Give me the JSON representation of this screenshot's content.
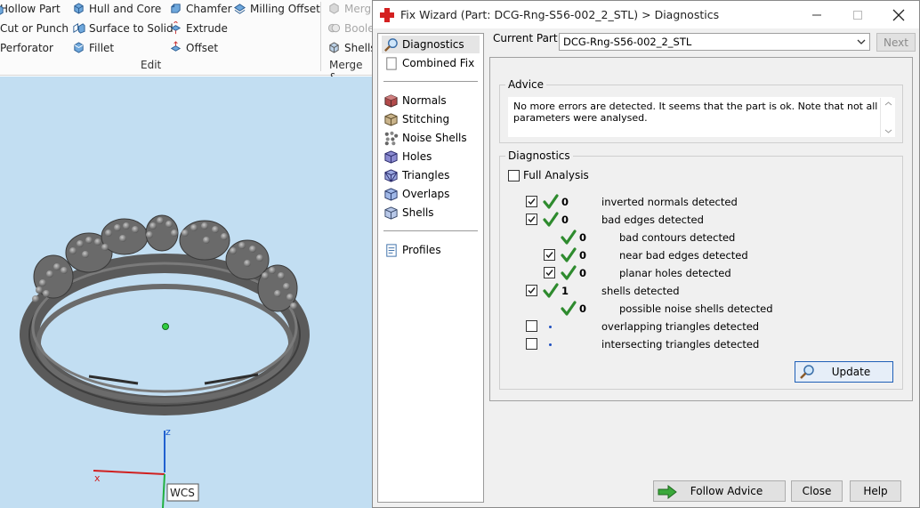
{
  "ribbon": {
    "items": [
      {
        "label": "Hollow Part",
        "icon": "hollow-part-icon"
      },
      {
        "label": "Cut or Punch",
        "icon": "cut-punch-icon"
      },
      {
        "label": "Perforator",
        "icon": "perforator-icon"
      },
      {
        "label": "Hull and Core",
        "icon": "hull-core-icon"
      },
      {
        "label": "Surface to Solid",
        "icon": "surface-to-solid-icon"
      },
      {
        "label": "Fillet",
        "icon": "fillet-icon"
      },
      {
        "label": "Chamfer",
        "icon": "chamfer-icon"
      },
      {
        "label": "Extrude",
        "icon": "extrude-icon"
      },
      {
        "label": "Offset",
        "icon": "offset-icon"
      },
      {
        "label": "Milling Offset",
        "icon": "milling-offset-icon"
      },
      {
        "label": "Merg",
        "icon": "merge-icon"
      },
      {
        "label": "Boole",
        "icon": "boolean-icon"
      },
      {
        "label": "Shells",
        "icon": "shells-icon"
      }
    ],
    "group_edit": "Edit",
    "group_merge": "Merge &"
  },
  "viewport": {
    "axis_z": "z",
    "axis_x": "x",
    "wcs_label": "WCS"
  },
  "dialog": {
    "title": "Fix Wizard (Part: DCG-Rng-S56-002_2_STL) > Diagnostics",
    "nav": [
      {
        "label": "Diagnostics",
        "icon": "diagnostics-magnifier-icon"
      },
      {
        "label": "Combined Fix",
        "icon": "combined-fix-icon"
      },
      {
        "label": "Normals",
        "icon": "normals-cube-icon"
      },
      {
        "label": "Stitching",
        "icon": "stitching-cube-icon"
      },
      {
        "label": "Noise Shells",
        "icon": "noise-shells-icon"
      },
      {
        "label": "Holes",
        "icon": "holes-cube-icon"
      },
      {
        "label": "Triangles",
        "icon": "triangles-cube-icon"
      },
      {
        "label": "Overlaps",
        "icon": "overlaps-cube-icon"
      },
      {
        "label": "Shells",
        "icon": "shells-cube-icon"
      },
      {
        "label": "Profiles",
        "icon": "profiles-document-icon"
      }
    ],
    "current_part_label": "Current Part:",
    "current_part_value": "DCG-Rng-S56-002_2_STL",
    "next_label": "Next",
    "advice_legend": "Advice",
    "advice_text": "No more errors are detected. It seems that the part is ok. Note that not all parameters were analysed.",
    "diagnostics_legend": "Diagnostics",
    "full_analysis_label": "Full Analysis",
    "rows": [
      {
        "checkbox": true,
        "checked": true,
        "status": "ok",
        "count": "0",
        "label": "inverted normals detected"
      },
      {
        "checkbox": true,
        "checked": true,
        "status": "ok",
        "count": "0",
        "label": "bad edges detected"
      },
      {
        "checkbox": false,
        "checked": false,
        "status": "ok",
        "count": "0",
        "label": "bad contours detected"
      },
      {
        "checkbox": true,
        "checked": true,
        "status": "ok",
        "count": "0",
        "label": "near bad edges detected"
      },
      {
        "checkbox": true,
        "checked": true,
        "status": "ok",
        "count": "0",
        "label": "planar holes detected"
      },
      {
        "checkbox": true,
        "checked": true,
        "status": "ok",
        "count": "1",
        "label": "shells detected"
      },
      {
        "checkbox": false,
        "checked": false,
        "status": "ok",
        "count": "0",
        "label": "possible noise shells detected"
      },
      {
        "checkbox": true,
        "checked": false,
        "status": "pending",
        "count": "",
        "label": "overlapping triangles detected"
      },
      {
        "checkbox": true,
        "checked": false,
        "status": "pending",
        "count": "",
        "label": "intersecting triangles detected"
      }
    ],
    "update_label": "Update",
    "follow_advice_label": "Follow Advice",
    "close_label": "Close",
    "help_label": "Help"
  },
  "colors": {
    "viewport_bg": "#c2def2",
    "check_green": "#2e8b2e",
    "accent_blue": "#1f5fb7",
    "title_icon_red": "#d42020"
  }
}
